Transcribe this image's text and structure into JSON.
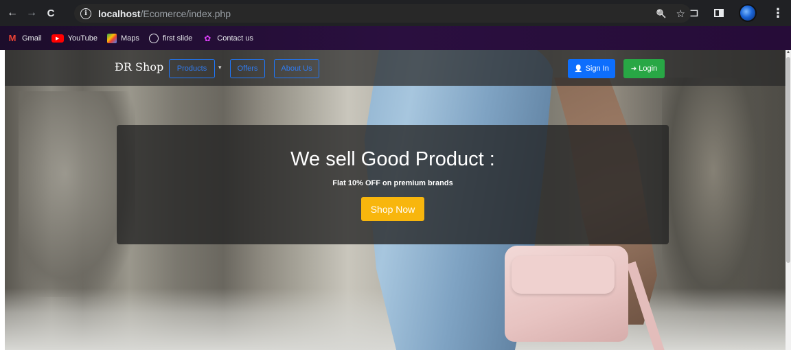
{
  "browser": {
    "url_host": "localhost",
    "url_path": "/Ecomerce/index.php",
    "icons": {
      "back": "←",
      "forward": "→",
      "reload": "C",
      "site_info": "i",
      "zoom": "🔍",
      "bookmark_star": "☆",
      "extensions": "⊐",
      "menu": "⋮"
    }
  },
  "bookmarks": [
    {
      "label": "Gmail",
      "icon": "gmail-icon"
    },
    {
      "label": "YouTube",
      "icon": "youtube-icon"
    },
    {
      "label": "Maps",
      "icon": "maps-icon"
    },
    {
      "label": "first slide",
      "icon": "globe-icon"
    },
    {
      "label": "Contact us",
      "icon": "contact-icon"
    }
  ],
  "site": {
    "brand": "ÐR Shop",
    "nav": {
      "products": "Products",
      "caret": "▾",
      "offers": "Offers",
      "about": "About Us"
    },
    "signin_icon": "👤",
    "signin_label": "Sign In",
    "login_icon": "➔",
    "login_label": "Login"
  },
  "hero": {
    "title": "We sell Good Product :",
    "subtitle": "Flat 10% OFF on premium brands",
    "cta": "Shop Now"
  },
  "colors": {
    "primary": "#0d6efd",
    "success": "#28a745",
    "warning": "#f8b60d",
    "chrome_bg": "#202124",
    "bookmark_bg": "#2a0f3f"
  }
}
